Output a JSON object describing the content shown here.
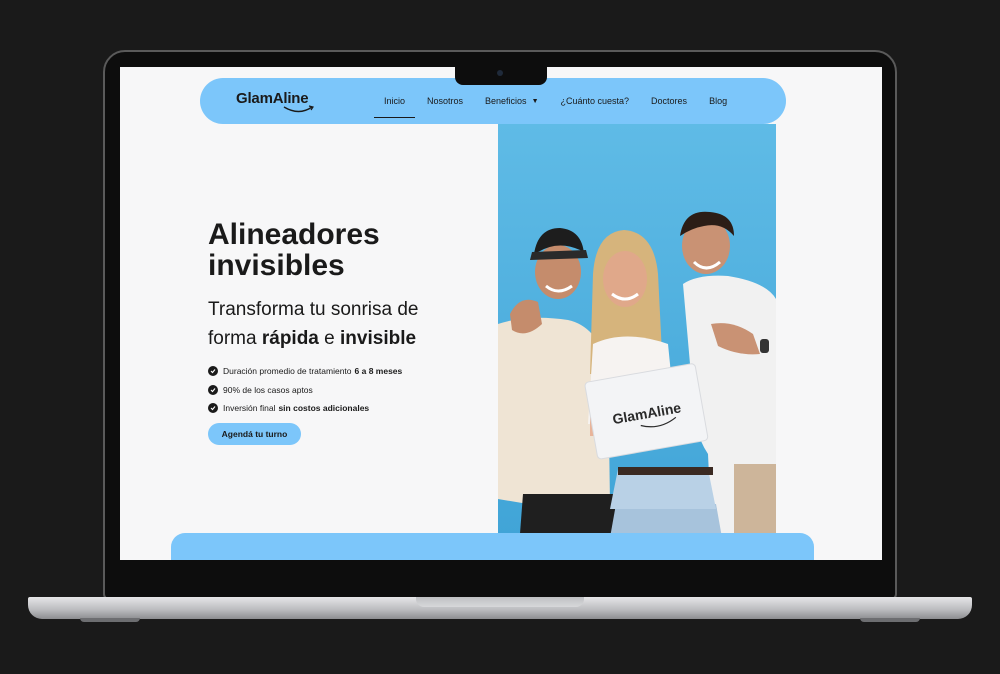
{
  "brand": {
    "logo": "GlamAline",
    "accent_color": "#7cc6fa",
    "text_color": "#1a1a1a"
  },
  "nav": {
    "items": [
      {
        "label": "Inicio",
        "active": true
      },
      {
        "label": "Nosotros"
      },
      {
        "label": "Beneficios",
        "has_dropdown": true,
        "icon": "caret-down-icon"
      },
      {
        "label": "¿Cuánto cuesta?"
      },
      {
        "label": "Doctores"
      },
      {
        "label": "Blog"
      }
    ]
  },
  "hero": {
    "title_line1": "Alineadores",
    "title_line2": "invisibles",
    "subtitle_line1": "Transforma tu sonrisa de",
    "subtitle_prefix": "forma",
    "subtitle_bold1": "rápida",
    "subtitle_mid": "e",
    "subtitle_bold2": "invisible",
    "bullets": [
      {
        "text": "Duración promedio de tratamiento",
        "bold": "6 a 8 meses",
        "icon": "check-circle-icon"
      },
      {
        "text": "90% de los casos aptos",
        "bold": "",
        "icon": "check-circle-icon"
      },
      {
        "text": "Inversión final",
        "bold": "sin costos adicionales",
        "icon": "check-circle-icon"
      }
    ],
    "cta_label": "Agendá tu turno"
  },
  "photo": {
    "box_logo": "GlamAline",
    "background_color": "#55b3e0"
  }
}
